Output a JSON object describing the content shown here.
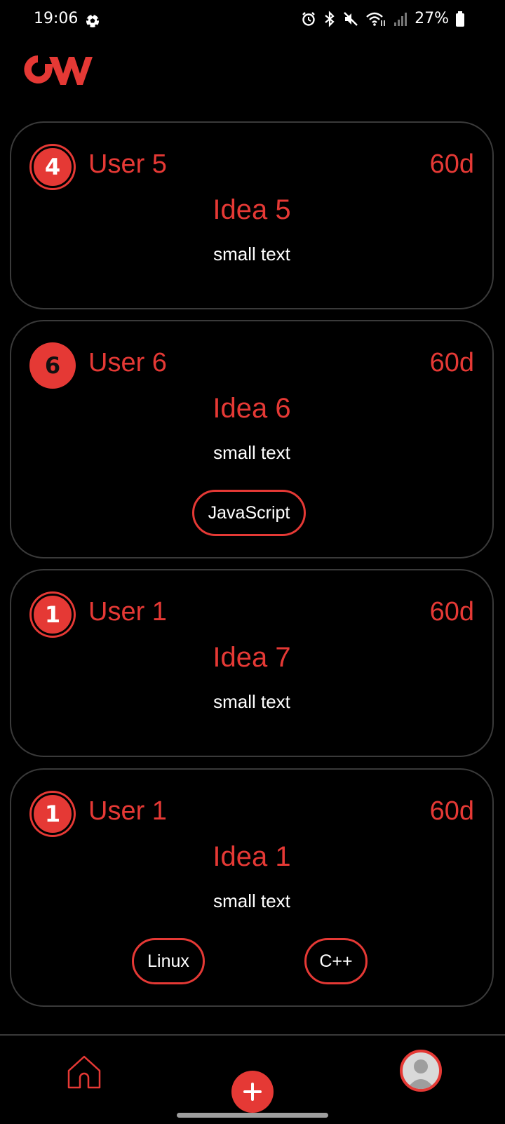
{
  "status_bar": {
    "time": "19:06",
    "battery": "27%"
  },
  "colors": {
    "accent": "#e53935",
    "background": "#000000",
    "card_border": "#3a3a3a"
  },
  "cards": [
    {
      "rank": "4",
      "user": "User 5",
      "age": "60d",
      "idea": "Idea 5",
      "text": "small text",
      "tags": []
    },
    {
      "rank": "6",
      "user": "User 6",
      "age": "60d",
      "idea": "Idea 6",
      "text": "small text",
      "tags": [
        "JavaScript"
      ]
    },
    {
      "rank": "1",
      "user": "User 1",
      "age": "60d",
      "idea": "Idea 7",
      "text": "small text",
      "tags": []
    },
    {
      "rank": "1",
      "user": "User 1",
      "age": "60d",
      "idea": "Idea 1",
      "text": "small text",
      "tags": [
        "Linux",
        "C++"
      ]
    }
  ],
  "nav": {
    "home_icon": "home-icon",
    "add_icon": "plus-icon",
    "profile_icon": "avatar-icon"
  }
}
